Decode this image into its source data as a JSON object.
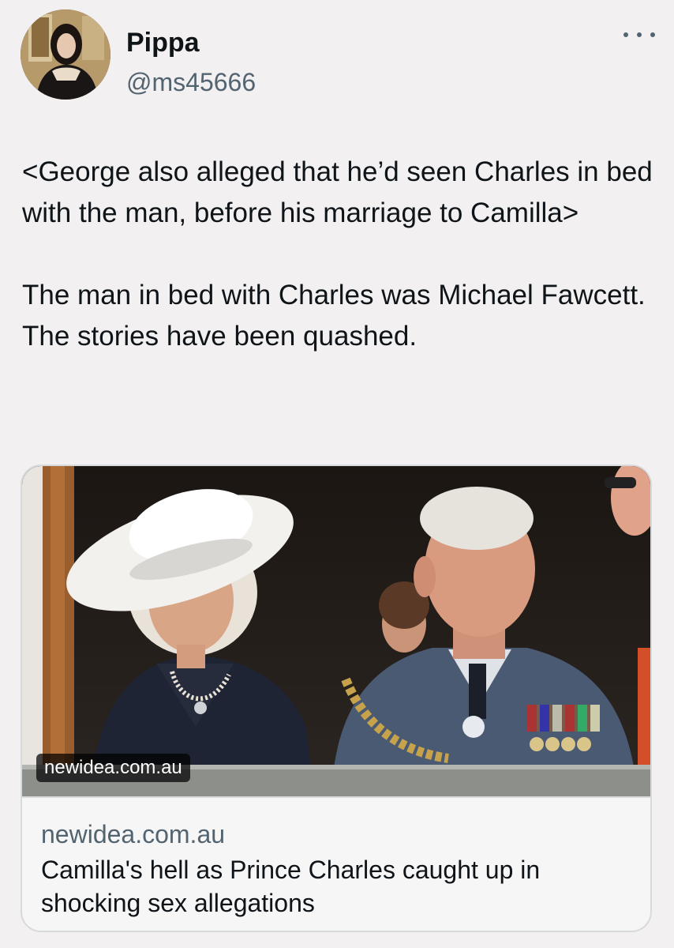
{
  "author": {
    "display_name": "Pippa",
    "handle": "@ms45666",
    "avatar_icon": "avatar-photo"
  },
  "menu": {
    "icon": "more-horizontal-icon"
  },
  "tweet": {
    "paragraphs": [
      "<George also alleged that he’d seen Charles in bed with the man, before his marriage to Camilla>",
      "The man in bed with Charles was Michael Fawcett. The stories have been quashed."
    ]
  },
  "card": {
    "image_badge": "newidea.com.au",
    "domain": "newidea.com.au",
    "title": "Camilla's hell as Prince Charles caught up in shocking sex allegations"
  },
  "colors": {
    "background": "#f2f0f1",
    "text": "#0f1419",
    "secondary_text": "#536471",
    "border": "#d7d9db"
  }
}
